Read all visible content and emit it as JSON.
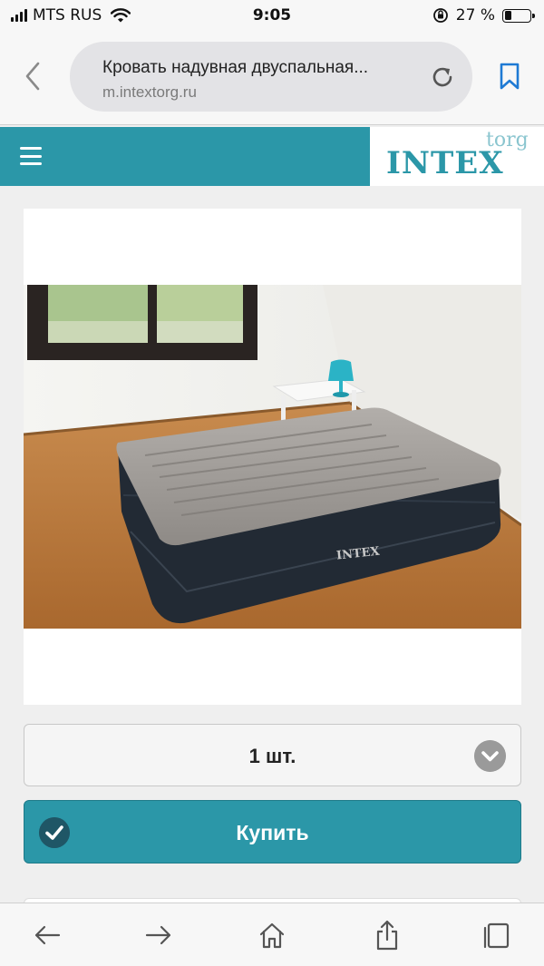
{
  "status_bar": {
    "carrier": "MTS RUS",
    "time": "9:05",
    "battery_percent": "27 %",
    "battery_level": 0.27
  },
  "browser": {
    "page_title": "Кровать надувная двуспальная...",
    "host": "m.intextorg.ru"
  },
  "site": {
    "logo_main": "INTEX",
    "logo_sub": "torg",
    "brand_color": "#2b97a8"
  },
  "product": {
    "image_label": "INTEX"
  },
  "quantity": {
    "selected": "1 шт."
  },
  "buy_button": {
    "label": "Купить"
  },
  "toolbar": {
    "icons": [
      "back-arrow-icon",
      "forward-arrow-icon",
      "home-icon",
      "share-icon",
      "tabs-icon"
    ]
  }
}
